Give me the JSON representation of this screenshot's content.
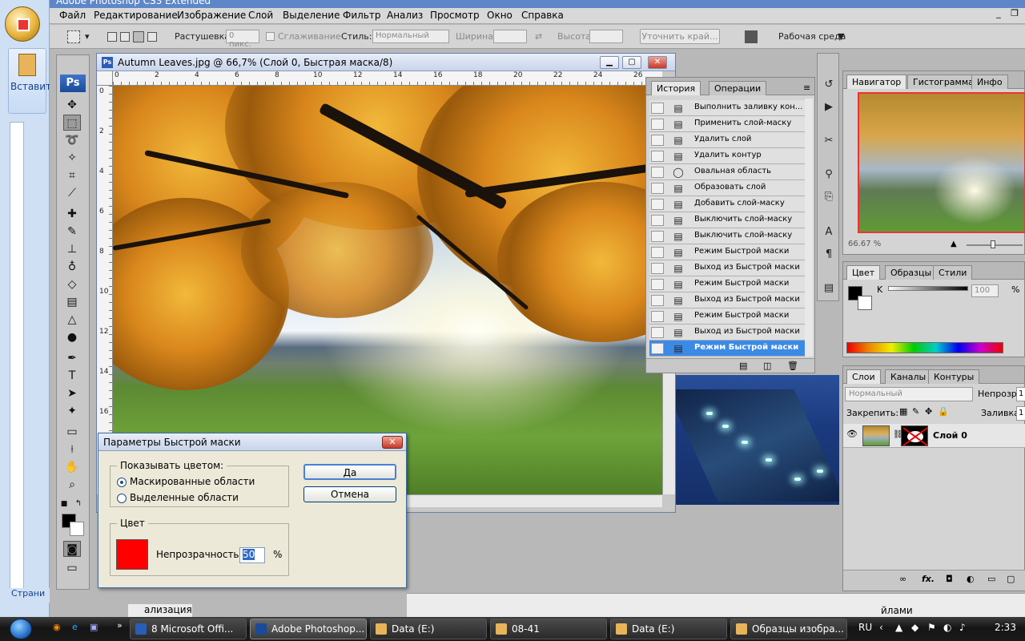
{
  "word": {
    "paste_label": "Вставить",
    "status_text": "Страни"
  },
  "app": {
    "title": "Adobe Photoshop CS3 Extended",
    "menu": [
      "Файл",
      "Редактирование",
      "Изображение",
      "Слой",
      "Выделение",
      "Фильтр",
      "Анализ",
      "Просмотр",
      "Окно",
      "Справка"
    ]
  },
  "options": {
    "feather_label": "Растушевка:",
    "feather_value": "0 пикс.",
    "antialias_label": "Сглаживание",
    "style_label": "Стиль:",
    "style_value": "Нормальный",
    "width_label": "Ширина:",
    "height_label": "Высота:",
    "refine_edge": "Уточнить край...",
    "workspace": "Рабочая среда"
  },
  "tools": {
    "logo": "Ps"
  },
  "document": {
    "title": "Autumn Leaves.jpg @ 66,7% (Слой 0, Быстрая маска/8)",
    "ruler_h": [
      "0",
      "2",
      "4",
      "6",
      "8",
      "10",
      "12",
      "14",
      "16",
      "18",
      "20",
      "22",
      "24",
      "26"
    ],
    "ruler_v": [
      "0",
      "2",
      "4",
      "6",
      "8",
      "10",
      "12",
      "14",
      "16"
    ]
  },
  "history": {
    "tabs": [
      "История",
      "Операции"
    ],
    "items": [
      "Выполнить заливку кон...",
      "Применить слой-маску",
      "Удалить слой",
      "Удалить контур",
      "Овальная область",
      "Образовать слой",
      "Добавить слой-маску",
      "Выключить слой-маску",
      "Выключить слой-маску",
      "Режим Быстрой маски",
      "Выход из Быстрой маски",
      "Режим Быстрой маски",
      "Выход из Быстрой маски",
      "Режим Быстрой маски",
      "Выход из Быстрой маски",
      "Режим Быстрой маски"
    ],
    "selected_index": 15
  },
  "navigator": {
    "tabs": [
      "Навигатор",
      "Гистограмма",
      "Инфо"
    ],
    "zoom": "66.67 %"
  },
  "color_panel": {
    "tabs": [
      "Цвет",
      "Образцы",
      "Стили"
    ],
    "channel": "K",
    "value": "100",
    "unit": "%"
  },
  "layers": {
    "tabs": [
      "Слои",
      "Каналы",
      "Контуры"
    ],
    "blend_mode": "Нормальный",
    "opacity_label": "Непрозр.:",
    "opacity_value": "1",
    "lock_label": "Закрепить:",
    "fill_label": "Заливка:",
    "fill_value": "1",
    "layer_name": "Слой 0",
    "foot_label": "fx."
  },
  "dialog": {
    "title": "Параметры Быстрой маски",
    "show_group": "Показывать цветом:",
    "option_masked": "Маскированные области",
    "option_selected": "Выделенные области",
    "ok": "Да",
    "cancel": "Отмена",
    "color_group": "Цвет",
    "opacity_label": "Непрозрачность:",
    "opacity_value": "50",
    "percent": "%",
    "mask_color": "#ff0000"
  },
  "taskbar": {
    "items": [
      {
        "label": "8 Microsoft Offi...",
        "icon_color": "#2a5db8"
      },
      {
        "label": "Adobe Photoshop...",
        "icon_color": "#1b4a99"
      },
      {
        "label": "Data (E:)",
        "icon_color": "#e7b45a"
      },
      {
        "label": "08-41",
        "icon_color": "#e7b45a"
      },
      {
        "label": "Data (E:)",
        "icon_color": "#e7b45a"
      },
      {
        "label": "Образцы изобра...",
        "icon_color": "#e7b45a"
      }
    ],
    "lang": "RU",
    "time": "2:33",
    "behind_text": "йлами",
    "behind_text2": "ализация"
  }
}
